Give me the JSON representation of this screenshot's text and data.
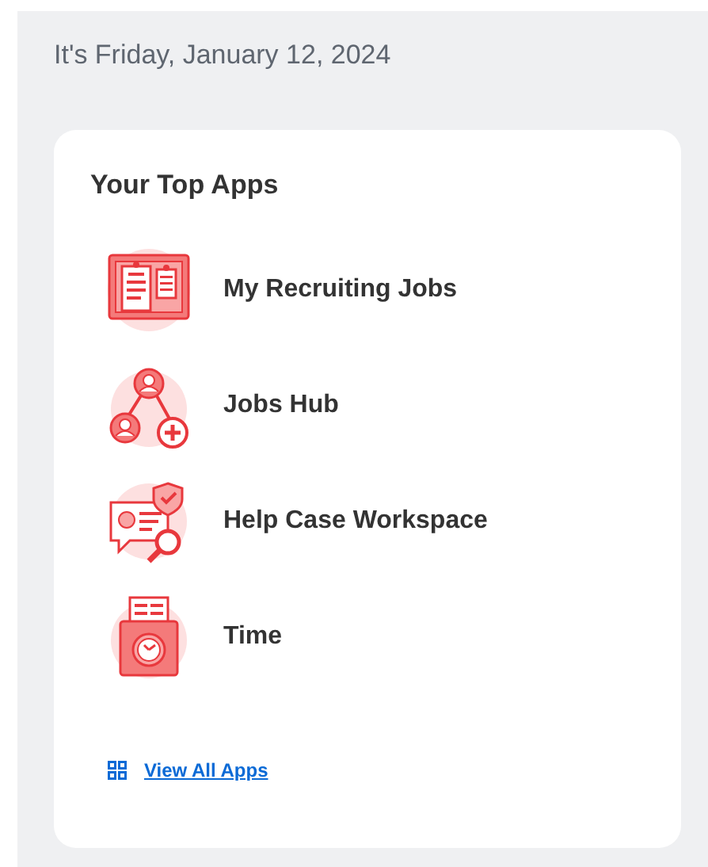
{
  "greeting": "It's Friday, January 12, 2024",
  "card": {
    "title": "Your Top Apps",
    "apps": [
      {
        "label": "My Recruiting Jobs",
        "kind": "boards"
      },
      {
        "label": "Jobs Hub",
        "kind": "network"
      },
      {
        "label": "Help Case Workspace",
        "kind": "case"
      },
      {
        "label": "Time",
        "kind": "clock"
      }
    ],
    "link": "View All Apps"
  }
}
